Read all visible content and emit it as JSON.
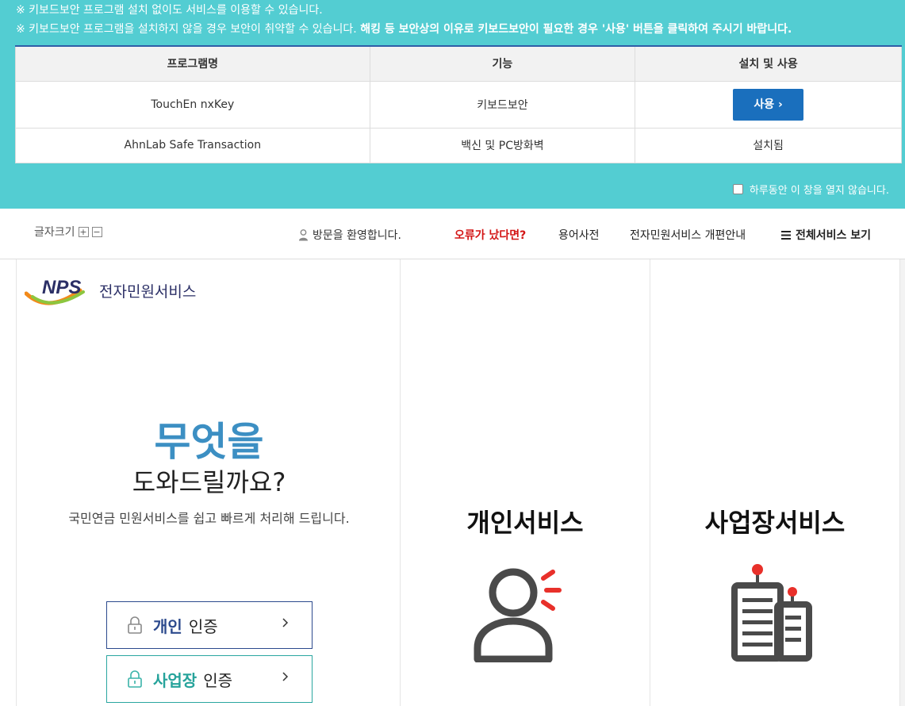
{
  "banner": {
    "notice1": "※ 키보드보안 프로그램 설치 없이도 서비스를 이용할 수 있습니다.",
    "notice2_normal": "※ 키보드보안 프로그램을 설치하지 않을 경우 보안이 취약할 수 있습니다.",
    "notice2_bold": "해킹 등 보안상의 이유로 키보드보안이 필요한 경우 '사용' 버튼을 클릭하여 주시기 바랍니다.",
    "table": {
      "headers": [
        "프로그램명",
        "기능",
        "설치 및 사용"
      ],
      "rows": [
        {
          "name": "TouchEn nxKey",
          "function": "키보드보안",
          "action": "사용 ›"
        },
        {
          "name": "AhnLab Safe Transaction",
          "function": "백신 및 PC방화벽",
          "action": "설치됨"
        }
      ]
    },
    "dont_show_today": "하루동안 이 창을 열지 않습니다."
  },
  "header": {
    "font_size_label": "글자크기",
    "font_plus": "+",
    "font_minus": "−",
    "welcome": "방문을 환영합니다.",
    "nav": {
      "error": "오류가 났다면?",
      "dictionary": "용어사전",
      "guide": "전자민원서비스 개편안내",
      "all_services": "전체서비스 보기"
    }
  },
  "main": {
    "logo_text": "전자민원서비스",
    "hero_line1": "무엇을",
    "hero_line2": "도와드릴까요?",
    "hero_sub": "국민연금 민원서비스를 쉽고 빠르게 처리해 드립니다.",
    "auth_personal_strong": "개인",
    "auth_personal_weak": "인증",
    "auth_biz_strong": "사업장",
    "auth_biz_weak": "인증",
    "personal_service": "개인서비스",
    "business_service": "사업장서비스"
  },
  "colors": {
    "banner_bg": "#53cdd2",
    "use_button": "#1a6fbd",
    "error_link": "#d31414",
    "personal_accent": "#2c4a8d",
    "business_accent": "#26a39b",
    "hero_blue": "#3c8fc3",
    "icon_red": "#e8302a",
    "icon_dark": "#4a4a4a"
  },
  "icons": [
    "user-icon",
    "menu-icon",
    "lock-icon",
    "chevron-right-icon",
    "person-service-icon",
    "building-service-icon",
    "nps-logo"
  ]
}
